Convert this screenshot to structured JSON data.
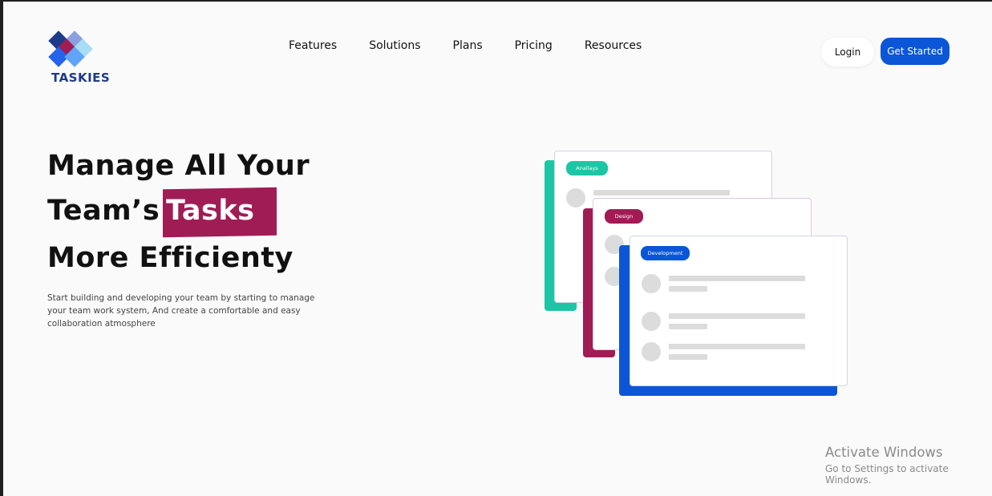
{
  "brand": {
    "name": "TASKIES",
    "logo_colors": [
      "#1e3a8a",
      "#3b82f6",
      "#a01c55",
      "#7dd3fc",
      "#60a5fa"
    ]
  },
  "nav": {
    "items": [
      "Features",
      "Solutions",
      "Plans",
      "Pricing",
      "Resources"
    ]
  },
  "actions": {
    "login_label": "Login",
    "get_started_label": "Get Started"
  },
  "hero": {
    "title_line1": "Manage All Your",
    "title_line2_prefix": "Team’s",
    "title_highlight": "Tasks",
    "title_line3": "More Efficienty",
    "description": "Start building and developing your team by starting to manage your team work system, And create a comfortable and easy collaboration atmosphere"
  },
  "illustration": {
    "cards": [
      {
        "tag": "Anallays",
        "color": "#1cc6a4"
      },
      {
        "tag": "Design",
        "color": "#a01c55"
      },
      {
        "tag": "Development",
        "color": "#0b56d6"
      }
    ]
  },
  "watermark": {
    "title": "Activate Windows",
    "subtitle": "Go to Settings to activate Windows."
  }
}
